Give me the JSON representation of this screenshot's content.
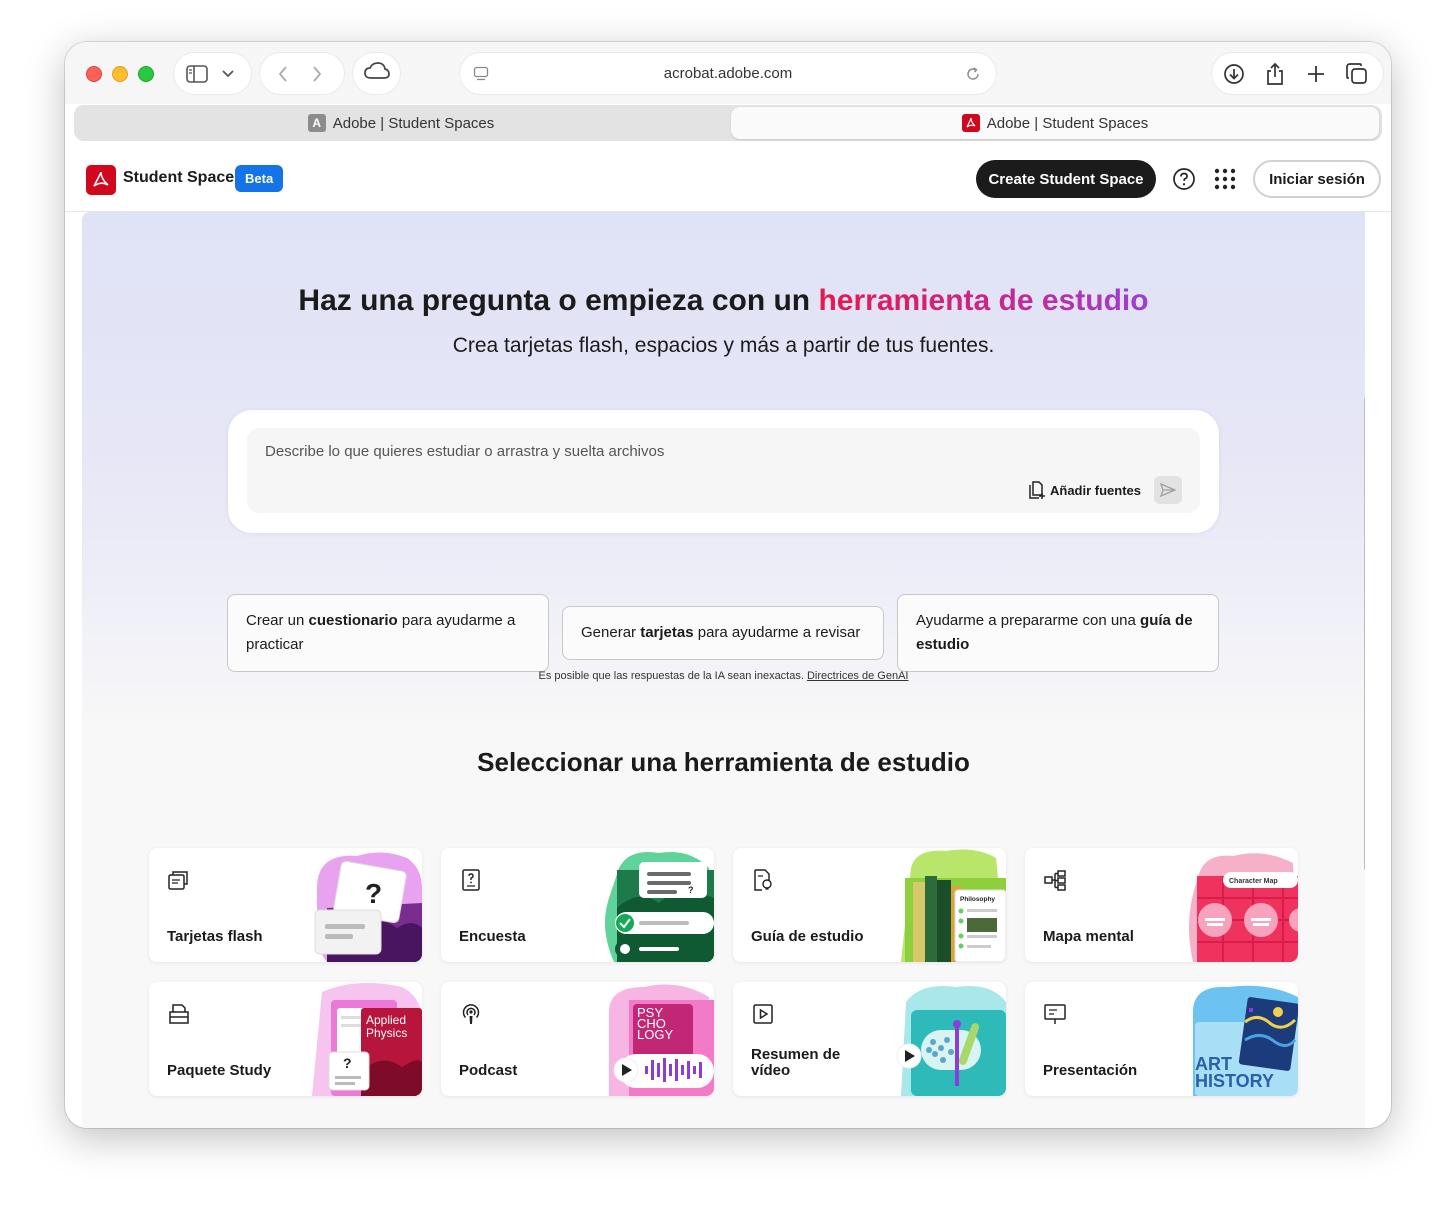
{
  "browser": {
    "url": "acrobat.adobe.com",
    "tabs": [
      {
        "title": "Adobe | Student Spaces"
      },
      {
        "title": "Adobe | Student Spaces"
      }
    ]
  },
  "header": {
    "brand": "Student Spaces",
    "badge": "Beta",
    "create_button": "Create Student Space",
    "signin_button": "Iniciar sesión"
  },
  "hero": {
    "title_plain": "Haz una pregunta o empieza con un ",
    "title_highlight": "herramienta de estudio",
    "subtitle": "Crea tarjetas flash, espacios y más a partir de tus fuentes.",
    "prompt_placeholder": "Describe lo que quieres estudiar o arrastra y suelta archivos",
    "add_sources": "Añadir fuentes"
  },
  "suggestions": [
    {
      "pre": "Crear un ",
      "bold": "cuestionario",
      "post": " para ayudarme a practicar"
    },
    {
      "pre": "Generar ",
      "bold": "tarjetas",
      "post": " para ayudarme a revisar"
    },
    {
      "pre": "Ayudarme a prepararme con una ",
      "bold": "guía de estudio",
      "post": ""
    }
  ],
  "disclaimer": {
    "text": "Es posible que las respuestas de la IA sean inexactas. ",
    "link": "Directrices de GenAI"
  },
  "tools_title": "Seleccionar una herramienta de estudio",
  "tools": [
    {
      "label": "Tarjetas flash",
      "icon": "flashcards-icon"
    },
    {
      "label": "Encuesta",
      "icon": "quiz-icon"
    },
    {
      "label": "Guía de estudio",
      "icon": "study-guide-icon"
    },
    {
      "label": "Mapa mental",
      "icon": "mind-map-icon"
    },
    {
      "label": "Paquete Study",
      "icon": "study-pack-icon"
    },
    {
      "label": "Podcast",
      "icon": "podcast-icon"
    },
    {
      "label": "Resumen de vídeo",
      "icon": "video-summary-icon"
    },
    {
      "label": "Presentación",
      "icon": "presentation-icon"
    }
  ],
  "art_text": {
    "philosophy": "Philosophy",
    "character_map": "Character Map",
    "applied_physics": "Applied Physics",
    "psychology": "PSY CHO LOGY",
    "art_history": "ART HISTORY"
  },
  "colors": {
    "accent_blue": "#1473e6",
    "adobe_red": "#d1081d",
    "gradient_start": "#e8194a",
    "gradient_end": "#9b3fd6"
  }
}
